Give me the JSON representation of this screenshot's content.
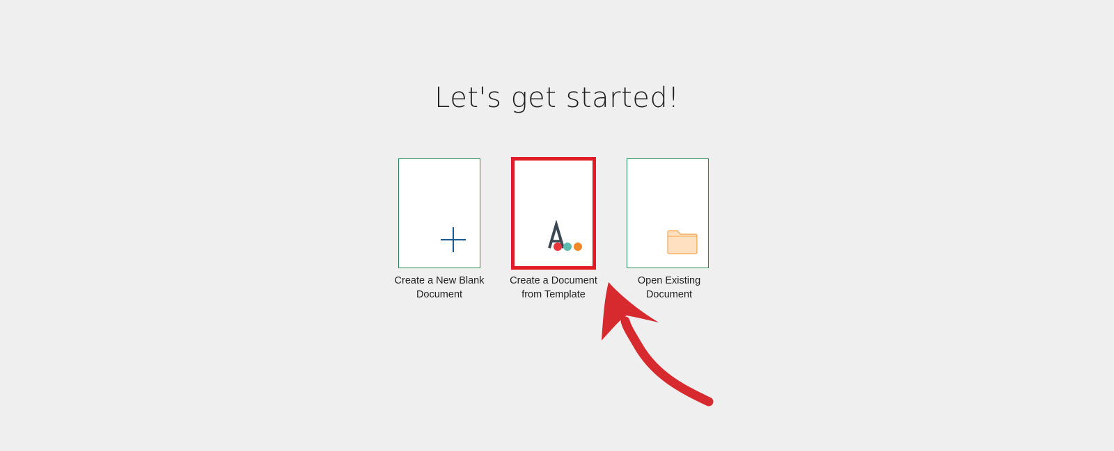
{
  "page": {
    "title": "Let's get started!"
  },
  "options": [
    {
      "id": "blank",
      "label_line1": "Create a New Blank",
      "label_line2": "Document",
      "icon": "plus-icon",
      "highlighted": false
    },
    {
      "id": "template",
      "label_line1": "Create a Document",
      "label_line2": "from Template",
      "icon": "template-letter-icon",
      "highlighted": true
    },
    {
      "id": "open",
      "label_line1": "Open Existing",
      "label_line2": "Document",
      "icon": "folder-icon",
      "highlighted": false
    }
  ],
  "icon_colors": {
    "plus": "#1a5a8f",
    "template_letter": "#3b4752",
    "template_dot_red": "#e8353b",
    "template_dot_teal": "#5bbcae",
    "template_dot_orange": "#f0892a",
    "folder_fill": "#ffe0c0",
    "folder_stroke": "#f2a44a"
  },
  "annotation": {
    "highlight_color": "#e01b24",
    "arrow_color": "#d62a2f"
  }
}
